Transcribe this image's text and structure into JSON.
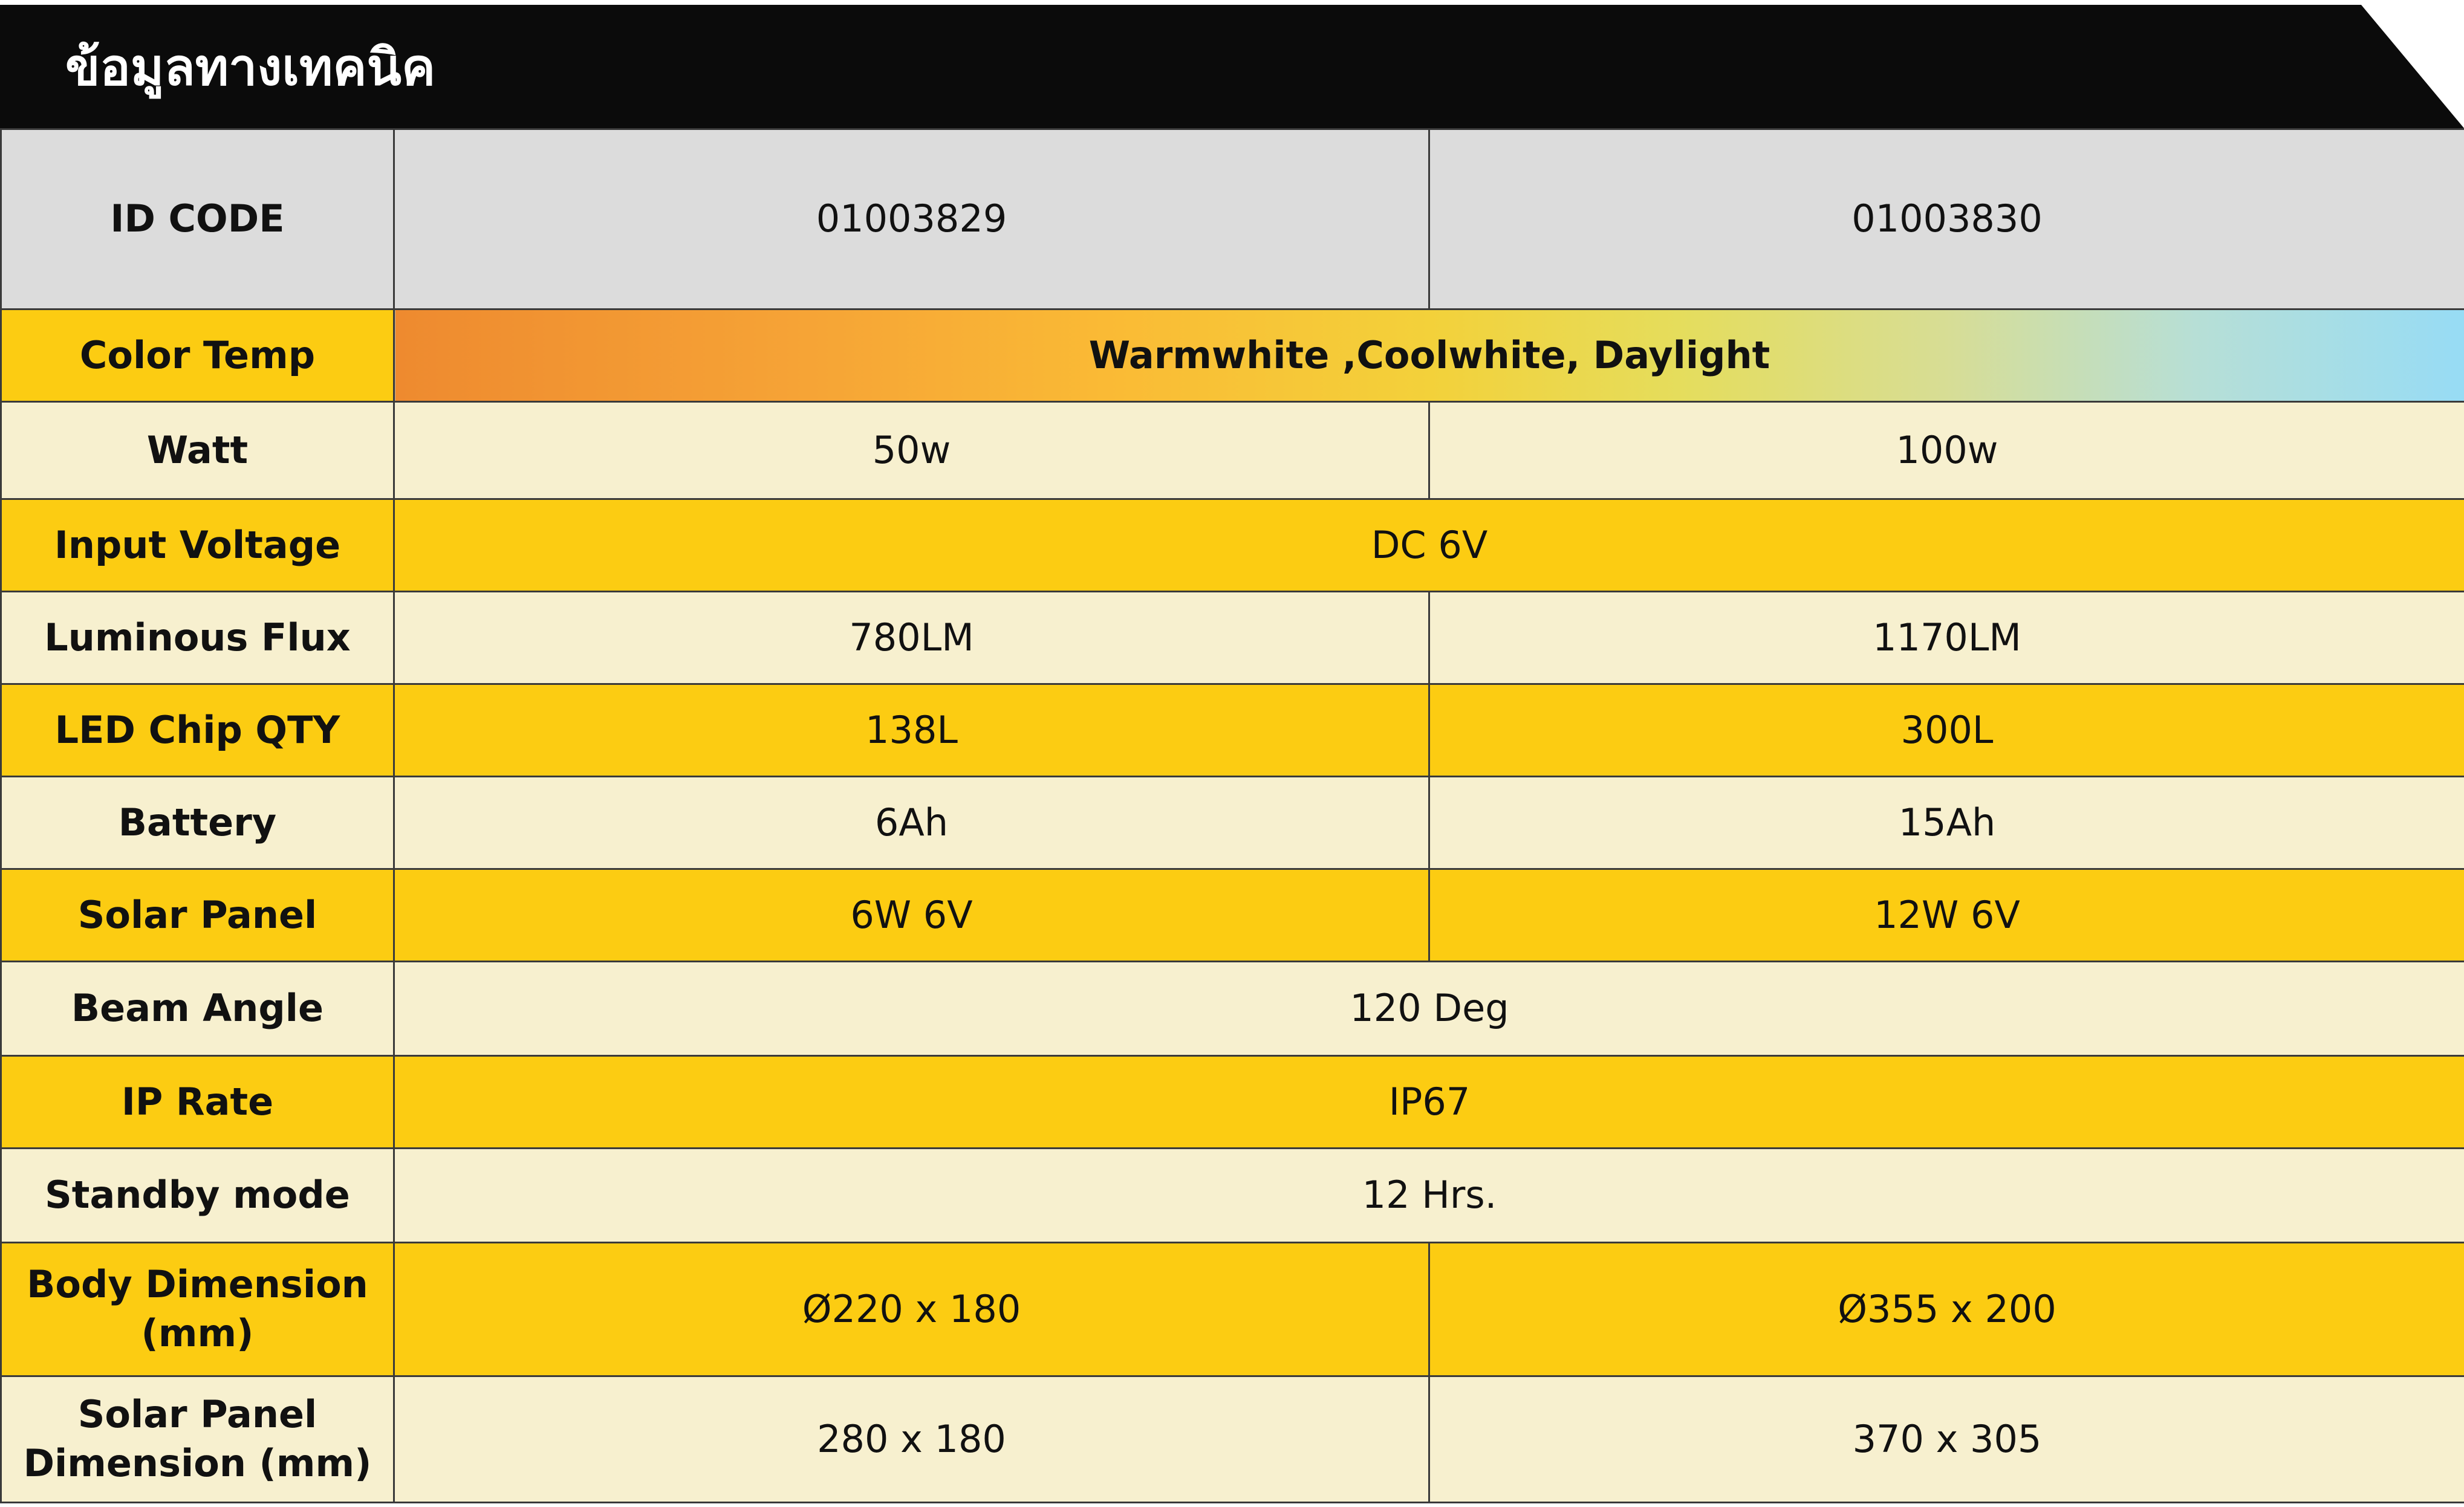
{
  "header": {
    "title": "ข้อมูลทางเทคนิค"
  },
  "colors": {
    "header_bg": "#0b0b0b",
    "yellow": "#fccc12",
    "cream": "#f7f0cf",
    "gray": "#dcdcdc"
  },
  "rows": {
    "id_code": {
      "label": "ID CODE",
      "v1": "01003829",
      "v2": "01003830"
    },
    "color_temp": {
      "label": "Color Temp",
      "value": "Warmwhite ,Coolwhite, Daylight"
    },
    "watt": {
      "label": "Watt",
      "v1": "50w",
      "v2": "100w"
    },
    "input_voltage": {
      "label": "Input Voltage",
      "value": "DC 6V"
    },
    "luminous_flux": {
      "label": "Luminous Flux",
      "v1": "780LM",
      "v2": "1170LM"
    },
    "led_chip_qty": {
      "label": "LED Chip QTY",
      "v1": "138L",
      "v2": "300L"
    },
    "battery": {
      "label": "Battery",
      "v1": "6Ah",
      "v2": "15Ah"
    },
    "solar_panel": {
      "label": "Solar Panel",
      "v1": "6W 6V",
      "v2": "12W 6V"
    },
    "beam_angle": {
      "label": "Beam Angle",
      "value": "120 Deg"
    },
    "ip_rate": {
      "label": "IP Rate",
      "value": "IP67"
    },
    "standby_mode": {
      "label": "Standby mode",
      "value": "12 Hrs."
    },
    "body_dimension": {
      "label_line1": "Body Dimension",
      "label_line2": "(mm)",
      "v1": "Ø220 x 180",
      "v2": "Ø355 x 200"
    },
    "solar_panel_dimension": {
      "label_line1": "Solar Panel",
      "label_line2": "Dimension (mm)",
      "v1": "280 x 180",
      "v2": "370 x 305"
    }
  }
}
